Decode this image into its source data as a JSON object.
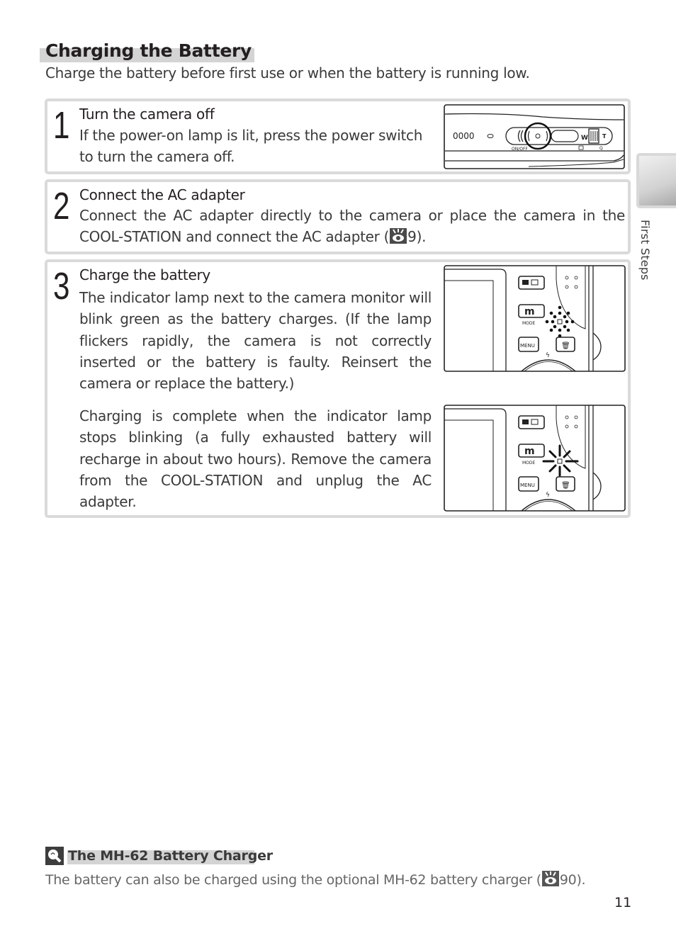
{
  "header": {
    "title": "Charging the Battery",
    "subtitle": "Charge the battery before first use or when the battery is running low."
  },
  "steps": [
    {
      "number": "1",
      "title": "Turn the camera off",
      "body": "If the power-on lamp is lit, press the power switch to turn the camera off.",
      "illustration": "camera-top-power-switch"
    },
    {
      "number": "2",
      "title": "Connect the AC adapter",
      "body_before_ref": "Connect the AC adapter directly to the camera or place the camera in the COOL-STATION and connect the AC adapter (",
      "ref_icon": "page-reference-icon",
      "ref_page": "9",
      "body_after_ref": ")."
    },
    {
      "number": "3",
      "title": "Charge the battery",
      "body": "The indicator lamp next to the camera monitor will blink green as the battery charges.  (If the lamp flickers rapidly, the camera is not correctly inserted or the battery is faulty.  Reinsert the camera or replace the battery.)",
      "body2": "Charging is complete when the indicator lamp stops blinking (a fully exhausted battery will recharge in about two hours).  Remove the camera from the COOL-STATION and unplug the AC adapter.",
      "illustrations": [
        "camera-back-lamp-blinking",
        "camera-back-lamp-steady"
      ],
      "labels": {
        "mode": "MODE",
        "menu": "MENU",
        "on_off": "ON/OFF"
      }
    }
  ],
  "sidebar": {
    "section_label": "First Steps"
  },
  "tip": {
    "icon": "tip-lightbulb-icon",
    "title": "The MH-62 Battery Charger",
    "body_before_ref": "The battery can also be charged using the optional MH-62 battery charger (",
    "ref_page": "90",
    "body_after_ref": ")."
  },
  "footer": {
    "page_number": "11"
  },
  "colors": {
    "frame_gray": "#dadada",
    "title_band": "#d4d4d4",
    "text": "#231f20"
  }
}
